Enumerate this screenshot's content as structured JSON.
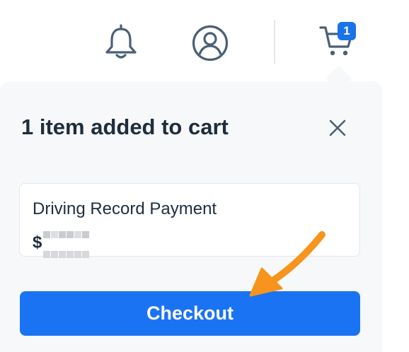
{
  "header": {
    "cart_count": "1",
    "icons": [
      "bell-icon",
      "user-icon",
      "cart-icon"
    ]
  },
  "cart_popover": {
    "title": "1 item added to cart",
    "item": {
      "name": "Driving Record Payment",
      "price_prefix": "$"
    },
    "checkout_label": "Checkout"
  },
  "colors": {
    "accent": "#1a73f3",
    "icon": "#4a6076",
    "text": "#1f2d3d",
    "panel": "#f7f8fa",
    "annotation_arrow": "#f7941d"
  }
}
